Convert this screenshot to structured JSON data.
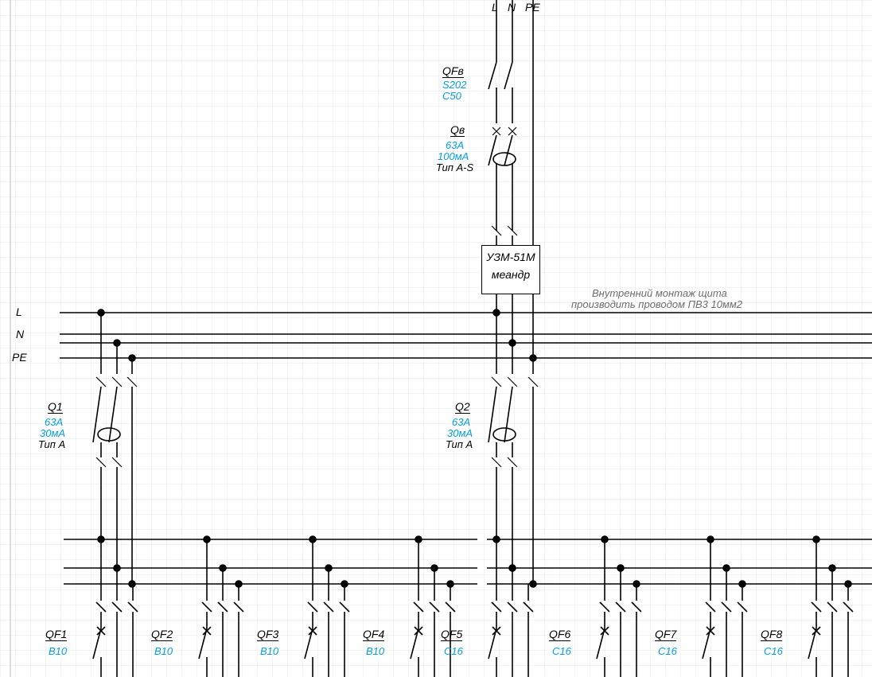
{
  "top_labels": {
    "L": "L",
    "N": "N",
    "PE": "PE"
  },
  "left_labels": {
    "L": "L",
    "N": "N",
    "PE": "PE"
  },
  "main_breaker": {
    "id": "QFв",
    "spec1": "S202",
    "spec2": "C50"
  },
  "main_rcd": {
    "id": "Qв",
    "spec1": "63А",
    "spec2": "100мА",
    "type": "Тип A-S"
  },
  "uzm": {
    "line1": "УЗМ-51М",
    "line2": "меандр"
  },
  "note": {
    "line1": "Внутренний монтаж щита",
    "line2": "производить проводом ПВ3 10мм2"
  },
  "q1": {
    "id": "Q1",
    "spec1": "63А",
    "spec2": "30мА",
    "type": "Тип A"
  },
  "q2": {
    "id": "Q2",
    "spec1": "63А",
    "spec2": "30мА",
    "type": "Тип A"
  },
  "branches": [
    {
      "id": "QF1",
      "spec": "B10"
    },
    {
      "id": "QF2",
      "spec": "B10"
    },
    {
      "id": "QF3",
      "spec": "B10"
    },
    {
      "id": "QF4",
      "spec": "B10"
    },
    {
      "id": "QF5",
      "spec": "C16"
    },
    {
      "id": "QF6",
      "spec": "C16"
    },
    {
      "id": "QF7",
      "spec": "C16"
    },
    {
      "id": "QF8",
      "spec": "C16"
    }
  ]
}
